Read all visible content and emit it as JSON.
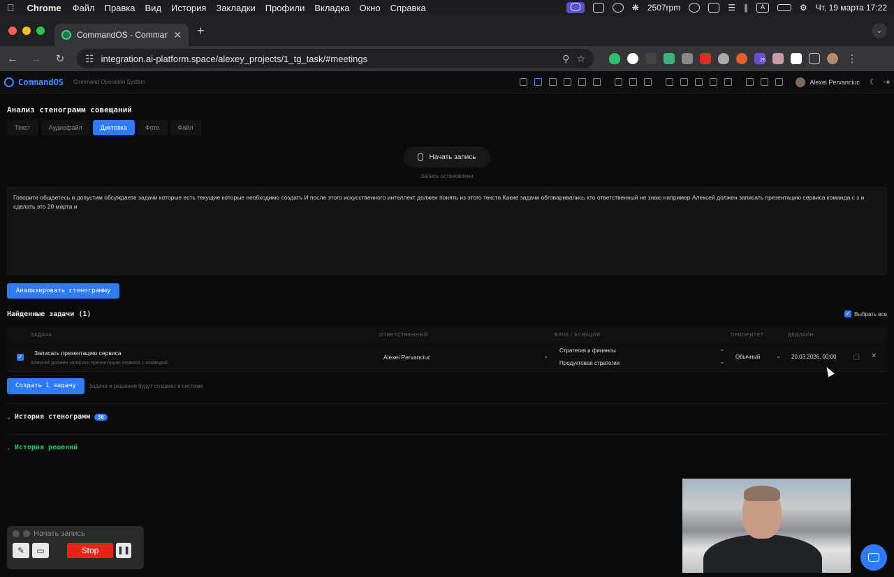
{
  "menubar": {
    "app_name": "Chrome",
    "items": [
      "Файл",
      "Правка",
      "Вид",
      "История",
      "Закладки",
      "Профили",
      "Вкладка",
      "Окно",
      "Справка"
    ],
    "rpm": "2507rpm",
    "datetime": "Чт, 19 марта  17:22"
  },
  "browser": {
    "tab_title": "CommandOS - Command Op",
    "url": "integration.ai-platform.space/alexey_projects/1_tg_task/#meetings",
    "ext_badge": "26"
  },
  "app": {
    "brand": "CommandOS",
    "brand_sub": "Command Operation System",
    "user_name": "Alexei Pervanciuc"
  },
  "page": {
    "title": "Анализ стенограмм совещаний",
    "tabs": [
      {
        "label": "Текст",
        "active": false
      },
      {
        "label": "Аудиофайл",
        "active": false
      },
      {
        "label": "Диктовка",
        "active": true
      },
      {
        "label": "Фото",
        "active": false
      },
      {
        "label": "Файл",
        "active": false
      }
    ],
    "record_label": "Начать запись",
    "record_status": "Запись остановлена",
    "transcript": "Говорите общаетесь и допустим обсуждаете задачи которые есть текущие которые необходимо создать И после этого искусственного интеллект должен понять из этого текста Какие задачи обговаривались кто ответственный не знаю например Алексей должен записать презентацию сервиса команда с з и сделать это 20 марта и",
    "analyze_label": "Анализировать стенограмму",
    "found_title": "Найденные задачи (1)",
    "select_all_label": "Выбрать все",
    "columns": {
      "task": "ЗАДАЧА",
      "owner": "ОТВЕТСТВЕННЫЙ",
      "block": "БЛОК / ФУНКЦИЯ",
      "priority": "ПРИОРИТЕТ",
      "deadline": "ДЕДЛАЙН"
    },
    "task": {
      "title": "Записать презентацию сервиса",
      "description": "Алексей должен записать презентацию сервиса с командой.",
      "owner": "Alexei Pervanciuc",
      "block": "Стратегия и финансы",
      "function": "Продуктовая стратегия",
      "priority": "Обычный",
      "deadline": "20.03.2026, 00:00"
    },
    "create_label": "Создать 1 задачу",
    "create_hint": "Задачи и решения будут созданы в системе",
    "history_label": "История стенограмм",
    "history_count": "50",
    "decisions_label": "История решений"
  },
  "recorder": {
    "title": "Начать запись",
    "stop_label": "Stop"
  },
  "colors": {
    "accent": "#2e7bf5",
    "decisions_green": "#2fbf71",
    "stop_red": "#e8231c"
  }
}
